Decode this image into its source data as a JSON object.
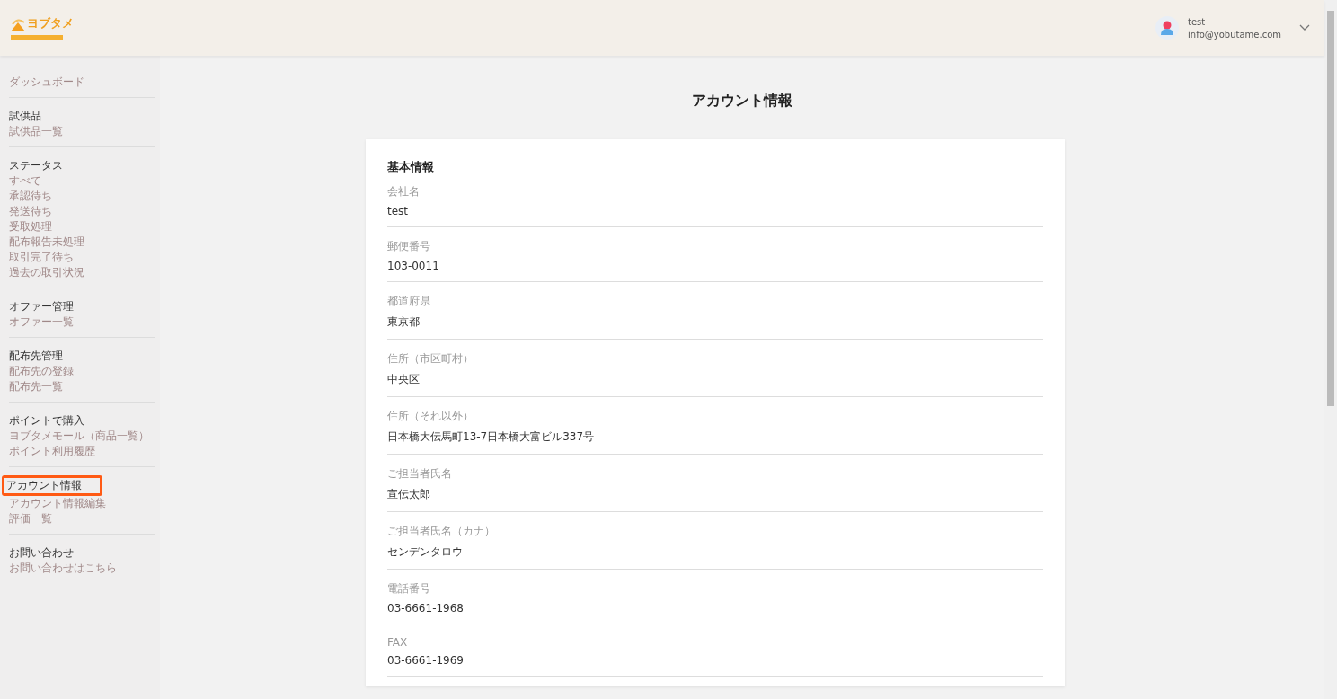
{
  "header": {
    "logo": {
      "text": "ヨブタメ"
    },
    "user": {
      "name": "test",
      "email": "info@yobutame.com"
    }
  },
  "sidebar": {
    "sections": [
      {
        "items": [
          {
            "label": "ダッシュボード",
            "highlighted": false
          }
        ]
      },
      {
        "heading": {
          "label": "試供品",
          "highlighted": false
        },
        "items": [
          {
            "label": "試供品一覧",
            "highlighted": false
          }
        ]
      },
      {
        "heading": {
          "label": "ステータス",
          "highlighted": false
        },
        "items": [
          {
            "label": "すべて",
            "highlighted": false
          },
          {
            "label": "承認待ち",
            "highlighted": false
          },
          {
            "label": "発送待ち",
            "highlighted": false
          },
          {
            "label": "受取処理",
            "highlighted": false
          },
          {
            "label": "配布報告未処理",
            "highlighted": false
          },
          {
            "label": "取引完了待ち",
            "highlighted": false
          },
          {
            "label": "過去の取引状況",
            "highlighted": false
          }
        ]
      },
      {
        "heading": {
          "label": "オファー管理",
          "highlighted": false
        },
        "items": [
          {
            "label": "オファー一覧",
            "highlighted": false
          }
        ]
      },
      {
        "heading": {
          "label": "配布先管理",
          "highlighted": false
        },
        "items": [
          {
            "label": "配布先の登録",
            "highlighted": false
          },
          {
            "label": "配布先一覧",
            "highlighted": false
          }
        ]
      },
      {
        "heading": {
          "label": "ポイントで購入",
          "highlighted": false
        },
        "items": [
          {
            "label": "ヨブタメモール（商品一覧）",
            "highlighted": false
          },
          {
            "label": "ポイント利用履歴",
            "highlighted": false
          }
        ]
      },
      {
        "heading": {
          "label": "アカウント情報",
          "highlighted": true
        },
        "items": [
          {
            "label": "アカウント情報編集",
            "highlighted": false
          },
          {
            "label": "評価一覧",
            "highlighted": false
          }
        ]
      },
      {
        "heading": {
          "label": "お問い合わせ",
          "highlighted": false
        },
        "items": [
          {
            "label": "お問い合わせはこちら",
            "highlighted": false
          }
        ]
      }
    ]
  },
  "page_title": "アカウント情報",
  "card": {
    "title": "基本情報",
    "fields": [
      {
        "label": "会社名",
        "value": "test"
      },
      {
        "label": "郵便番号",
        "value": "103-0011"
      },
      {
        "label": "都道府県",
        "value": "東京都"
      },
      {
        "label": "住所（市区町村）",
        "value": "中央区"
      },
      {
        "label": "住所（それ以外）",
        "value": "日本橋大伝馬町13-7日本橋大富ビル337号"
      },
      {
        "label": "ご担当者氏名",
        "value": "宣伝太郎"
      },
      {
        "label": "ご担当者氏名（カナ）",
        "value": "センデンタロウ"
      },
      {
        "label": "電話番号",
        "value": "03-6661-1968"
      },
      {
        "label": "FAX",
        "value": "03-6661-1969"
      }
    ]
  }
}
